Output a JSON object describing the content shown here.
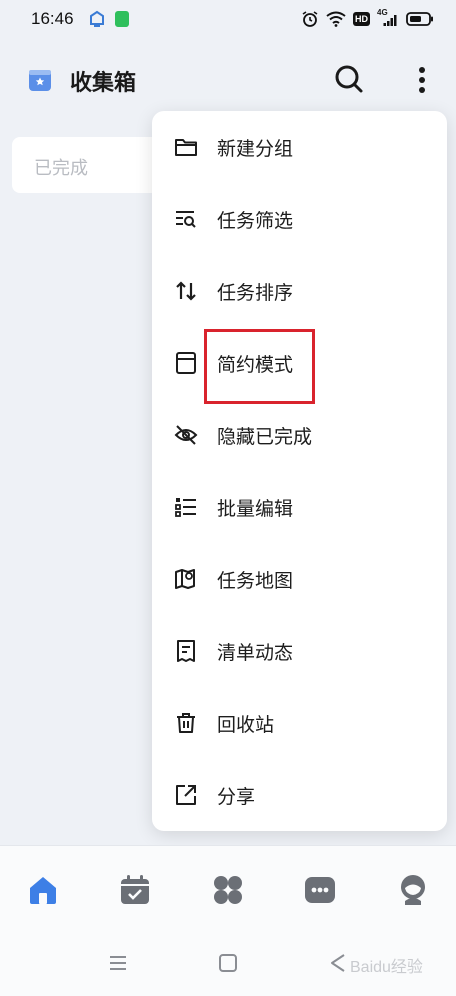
{
  "status_bar": {
    "time": "16:46",
    "hd_badge": "HD",
    "network_label": "4G"
  },
  "header": {
    "title": "收集箱"
  },
  "completed_section": {
    "label": "已完成"
  },
  "menu": {
    "items": [
      {
        "label": "新建分组",
        "icon": "folder-icon"
      },
      {
        "label": "任务筛选",
        "icon": "filter-search-icon"
      },
      {
        "label": "任务排序",
        "icon": "sort-icon"
      },
      {
        "label": "简约模式",
        "icon": "compact-mode-icon"
      },
      {
        "label": "隐藏已完成",
        "icon": "eye-off-icon"
      },
      {
        "label": "批量编辑",
        "icon": "batch-list-icon"
      },
      {
        "label": "任务地图",
        "icon": "map-pin-icon"
      },
      {
        "label": "清单动态",
        "icon": "receipt-icon"
      },
      {
        "label": "回收站",
        "icon": "trash-icon"
      },
      {
        "label": "分享",
        "icon": "share-icon"
      }
    ]
  },
  "tab_bar": {
    "tabs": [
      "home-icon",
      "calendar-icon",
      "apps-icon",
      "chat-icon",
      "profile-icon"
    ],
    "active_color": "#3d7fe6",
    "inactive_color": "#6b6f76"
  },
  "watermark": {
    "text": "Baidu经验"
  },
  "colors": {
    "highlight_border": "#d9232d",
    "accent": "#3d7fe6"
  }
}
